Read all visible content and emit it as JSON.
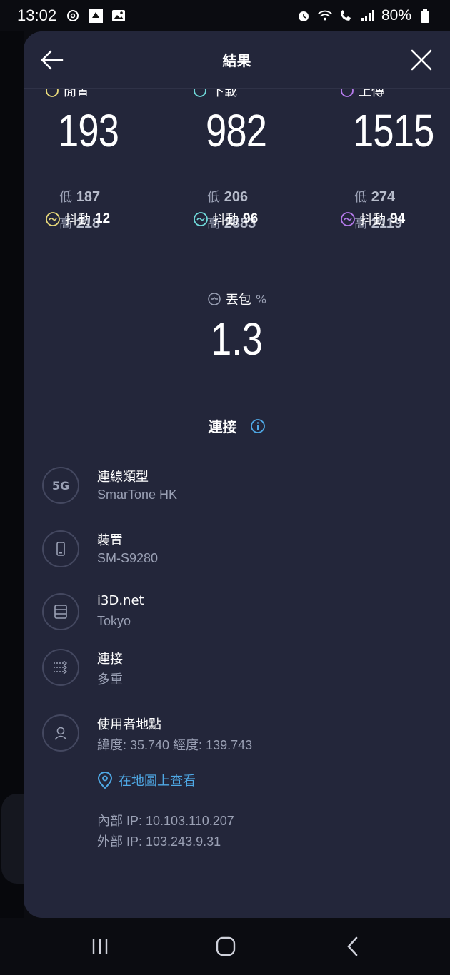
{
  "status_bar": {
    "time": "13:02",
    "battery": "80%",
    "left_icons": [
      "threads-icon",
      "app-icon",
      "gallery-icon"
    ],
    "right_icons": [
      "alarm-icon",
      "wifi-icon",
      "wifi-call-icon",
      "signal-icon",
      "battery-icon"
    ]
  },
  "header": {
    "title": "結果"
  },
  "metrics": [
    {
      "label": "閒置",
      "value": "193",
      "low_label": "低",
      "low": "187",
      "high_label": "高",
      "high": "218",
      "jitter_label": "抖動",
      "jitter": "12",
      "color": "#e8d97a"
    },
    {
      "label": "下載",
      "value": "982",
      "low_label": "低",
      "low": "206",
      "high_label": "高",
      "high": "2883",
      "jitter_label": "抖動",
      "jitter": "96",
      "color": "#6fd8d8"
    },
    {
      "label": "上傳",
      "value": "1515",
      "low_label": "低",
      "low": "274",
      "high_label": "高",
      "high": "2119",
      "jitter_label": "抖動",
      "jitter": "94",
      "color": "#b57aeb"
    }
  ],
  "packet_loss": {
    "label": "丟包",
    "unit": "%",
    "value": "1.3"
  },
  "connection": {
    "title": "連接",
    "rows": [
      {
        "icon": "5G",
        "title": "連線類型",
        "sub": "SmarTone HK"
      },
      {
        "icon": "phone-icon",
        "title": "裝置",
        "sub": "SM-S9280"
      },
      {
        "icon": "server-icon",
        "title": "i3D.net",
        "sub": "Tokyo"
      },
      {
        "icon": "multi-connection-icon",
        "title": "連接",
        "sub": "多重"
      },
      {
        "icon": "user-icon",
        "title": "使用者地點",
        "sub": "緯度: 35.740  經度: 139.743"
      }
    ],
    "map_link": "在地圖上查看",
    "internal_ip": "內部 IP: 10.103.110.207",
    "external_ip": "外部 IP: 103.243.9.31"
  },
  "colors": {
    "accent": "#4fa9e6",
    "sheet_bg": "#23263a"
  }
}
